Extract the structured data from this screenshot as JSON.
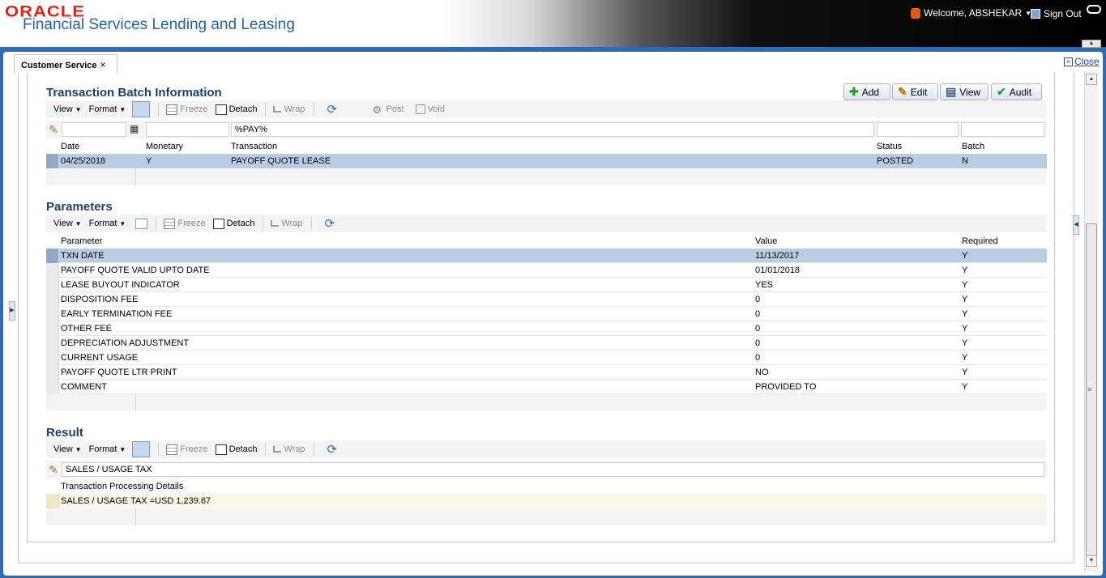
{
  "header": {
    "logo": "ORACLE",
    "product": "Financial Services Lending and Leasing",
    "welcome": "Welcome, ABSHEKAR",
    "sign_out": "Sign Out"
  },
  "tab": {
    "label": "Customer Service",
    "close_x": "×",
    "close_link": "Close"
  },
  "toolbar_labels": {
    "view": "View",
    "format": "Format",
    "freeze": "Freeze",
    "detach": "Detach",
    "wrap": "Wrap",
    "post": "Post",
    "void": "Void"
  },
  "buttons": {
    "add": "Add",
    "edit": "Edit",
    "view": "View",
    "audit": "Audit"
  },
  "batch": {
    "title": "Transaction Batch Information",
    "filter_transaction": "%PAY%",
    "headers": [
      "Date",
      "Monetary",
      "Transaction",
      "Status",
      "Batch"
    ],
    "rows": [
      [
        "04/25/2018",
        "Y",
        "PAYOFF QUOTE LEASE",
        "POSTED",
        "N"
      ]
    ]
  },
  "parameters": {
    "title": "Parameters",
    "headers": [
      "Parameter",
      "Value",
      "Required"
    ],
    "rows": [
      [
        "TXN DATE",
        "11/13/2017",
        "Y"
      ],
      [
        "PAYOFF QUOTE VALID UPTO DATE",
        "01/01/2018",
        "Y"
      ],
      [
        "LEASE BUYOUT INDICATOR",
        "YES",
        "Y"
      ],
      [
        "DISPOSITION FEE",
        "0",
        "Y"
      ],
      [
        "EARLY TERMINATION FEE",
        "0",
        "Y"
      ],
      [
        "OTHER FEE",
        "0",
        "Y"
      ],
      [
        "DEPRECIATION ADJUSTMENT",
        "0",
        "Y"
      ],
      [
        "CURRENT USAGE",
        "0",
        "Y"
      ],
      [
        "PAYOFF QUOTE LTR PRINT",
        "NO",
        "Y"
      ],
      [
        "COMMENT",
        "PROVIDED TO",
        "Y"
      ]
    ]
  },
  "result": {
    "title": "Result",
    "filter": "SALES / USAGE TAX",
    "header": "Transaction Processing Details",
    "row": "SALES / USAGE TAX =USD 1,239.67"
  },
  "colors": {
    "accent": "#2d6cb5",
    "brand_red": "#e2231a",
    "selected_row": "#b8cce4"
  }
}
